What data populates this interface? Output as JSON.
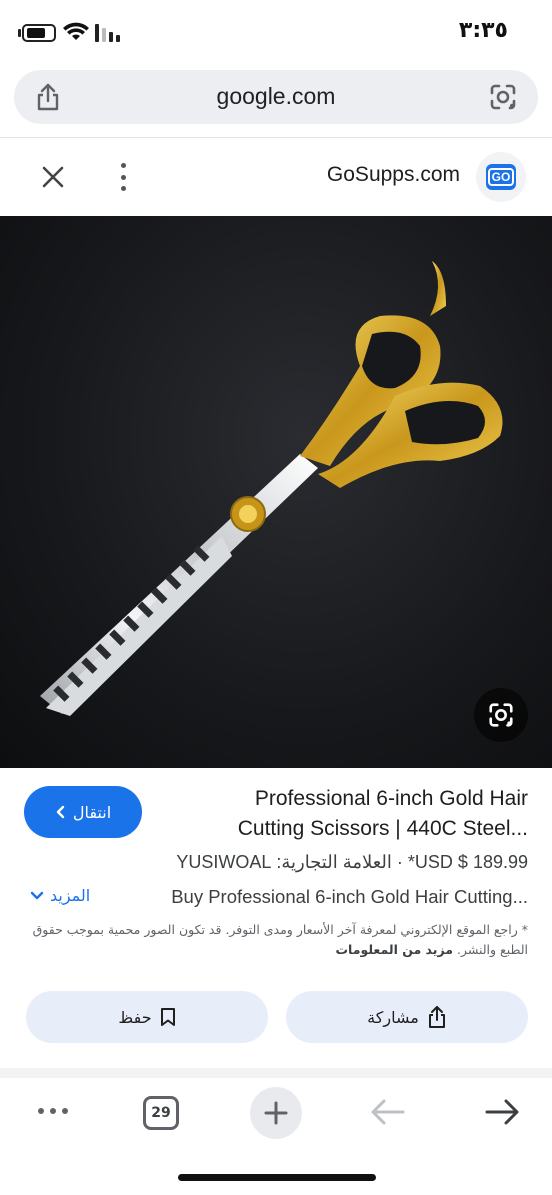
{
  "status_bar": {
    "time": "٣:٣٥"
  },
  "browser": {
    "url": "google.com"
  },
  "source": {
    "site_name": "GoSupps.com",
    "favicon_text": "GO"
  },
  "product": {
    "title": "Professional 6-inch Gold Hair Cutting Scissors | 440C Steel...",
    "price_line": "USD $ 189.99* · العلامة التجارية: YUSIWOAL",
    "description": "Buy Professional 6-inch Gold Hair Cutting...",
    "more_label": "المزيد",
    "go_label": "انتقال",
    "disclaimer_text": "* راجع الموقع الإلكتروني لمعرفة آخر الأسعار ومدى التوفر. قد تكون الصور محمية بموجب حقوق الطبع والنشر.",
    "disclaimer_link": "مزيد من المعلومات"
  },
  "actions": {
    "save_label": "حفظ",
    "share_label": "مشاركة"
  },
  "toolbar": {
    "tab_count": "29"
  },
  "colors": {
    "accent": "#1a73e8",
    "pill_bg": "#e8eef9",
    "gold": "#d4a92a"
  }
}
